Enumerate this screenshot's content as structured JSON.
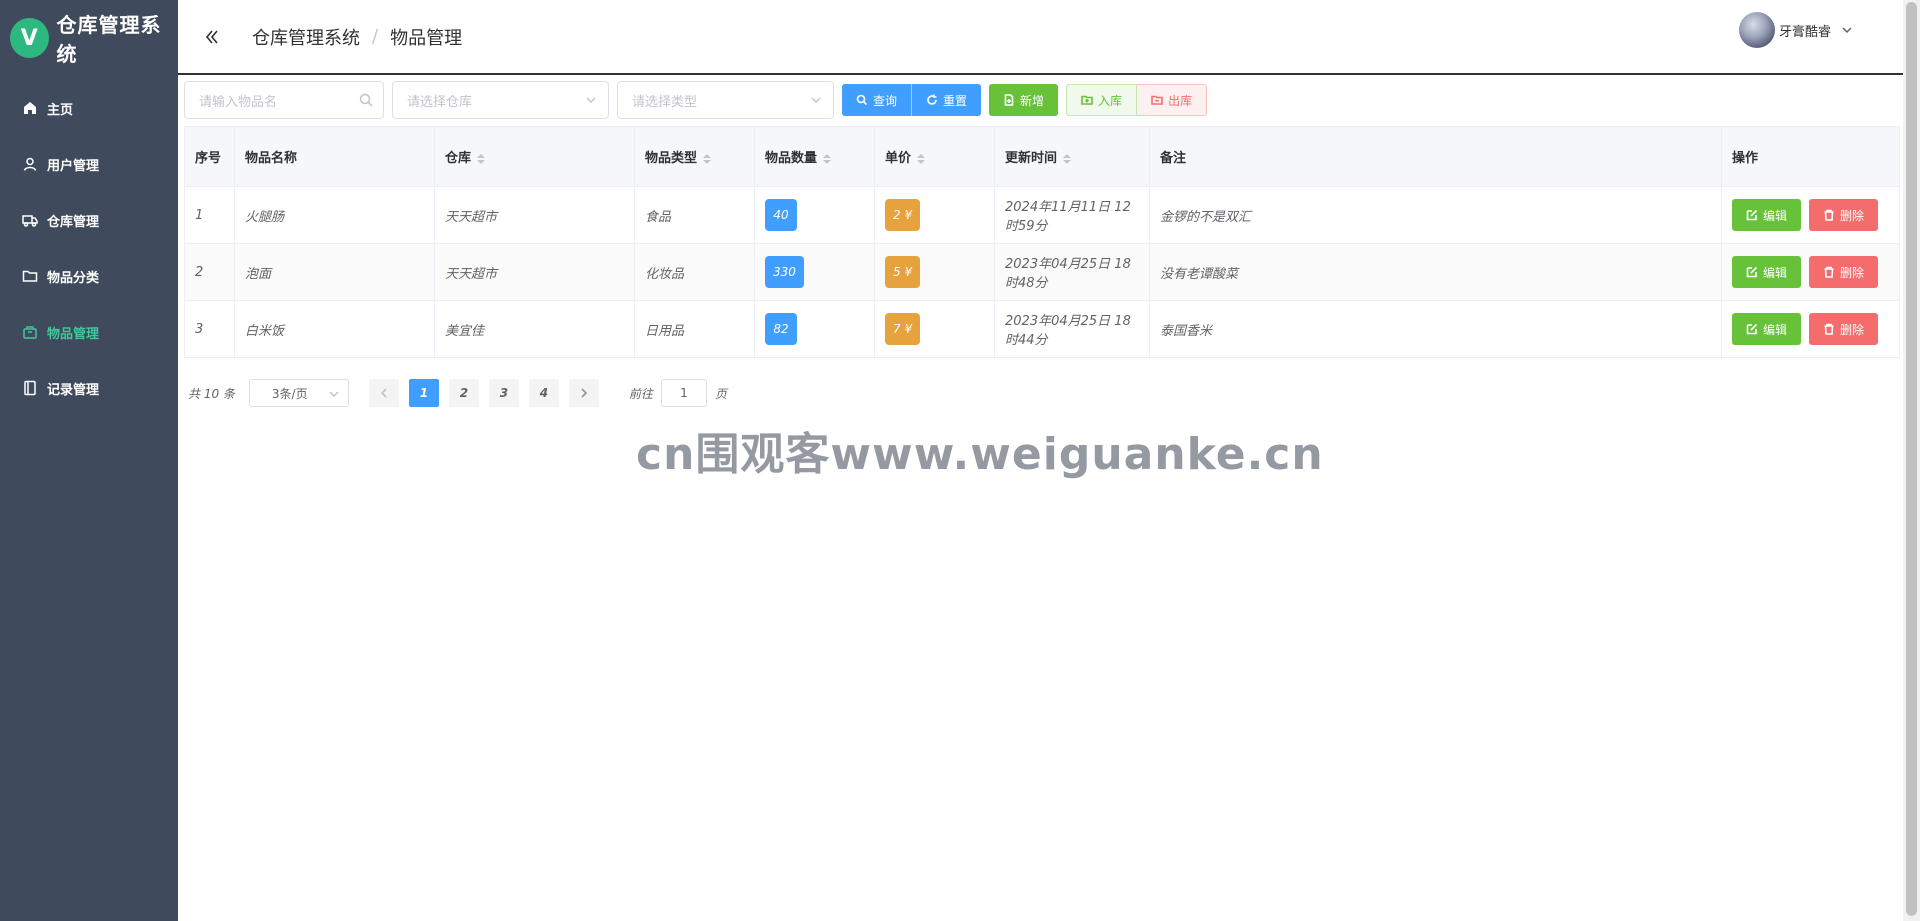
{
  "app": {
    "logo_letter": "V",
    "title": "仓库管理系统"
  },
  "sidebar": {
    "items": [
      {
        "label": "主页",
        "icon": "home-icon"
      },
      {
        "label": "用户管理",
        "icon": "user-icon"
      },
      {
        "label": "仓库管理",
        "icon": "truck-icon"
      },
      {
        "label": "物品分类",
        "icon": "folder-icon"
      },
      {
        "label": "物品管理",
        "icon": "box-icon",
        "active": true
      },
      {
        "label": "记录管理",
        "icon": "notebook-icon"
      }
    ]
  },
  "header": {
    "breadcrumb": [
      "仓库管理系统",
      "物品管理"
    ],
    "separator": "/",
    "user_name": "牙膏酷睿"
  },
  "toolbar": {
    "search_placeholder": "请输入物品名",
    "warehouse_placeholder": "请选择仓库",
    "type_placeholder": "请选择类型",
    "query_label": "查询",
    "reset_label": "重置",
    "add_label": "新增",
    "stock_in_label": "入库",
    "stock_out_label": "出库"
  },
  "table": {
    "headers": [
      "序号",
      "物品名称",
      "仓库",
      "物品类型",
      "物品数量",
      "单价",
      "更新时间",
      "备注",
      "操作"
    ],
    "rows": [
      {
        "no": "1",
        "name": "火腿肠",
        "warehouse": "天天超市",
        "type": "食品",
        "qty": "40",
        "price": "2 ¥",
        "updated": "2024年11月11日 12时59分",
        "remark": "金锣的不是双汇"
      },
      {
        "no": "2",
        "name": "泡面",
        "warehouse": "天天超市",
        "type": "化妆品",
        "qty": "330",
        "price": "5 ¥",
        "updated": "2023年04月25日 18时48分",
        "remark": "没有老谭酸菜"
      },
      {
        "no": "3",
        "name": "白米饭",
        "warehouse": "美宜佳",
        "type": "日用品",
        "qty": "82",
        "price": "7 ¥",
        "updated": "2023年04月25日 18时44分",
        "remark": "泰国香米"
      }
    ],
    "edit_label": "编辑",
    "delete_label": "删除"
  },
  "pagination": {
    "total": "共 10 条",
    "page_size": "3条/页",
    "pages": [
      "1",
      "2",
      "3",
      "4"
    ],
    "current": "1",
    "goto_prefix": "前往",
    "goto_value": "1",
    "goto_suffix": "页"
  },
  "watermark": "cn围观客www.weiguanke.cn",
  "colors": {
    "sidebar_bg": "#3f4a5c",
    "accent": "#43c69a",
    "primary": "#409eff",
    "success": "#67c23a",
    "warning": "#e6a23c",
    "danger": "#f56c6c"
  }
}
